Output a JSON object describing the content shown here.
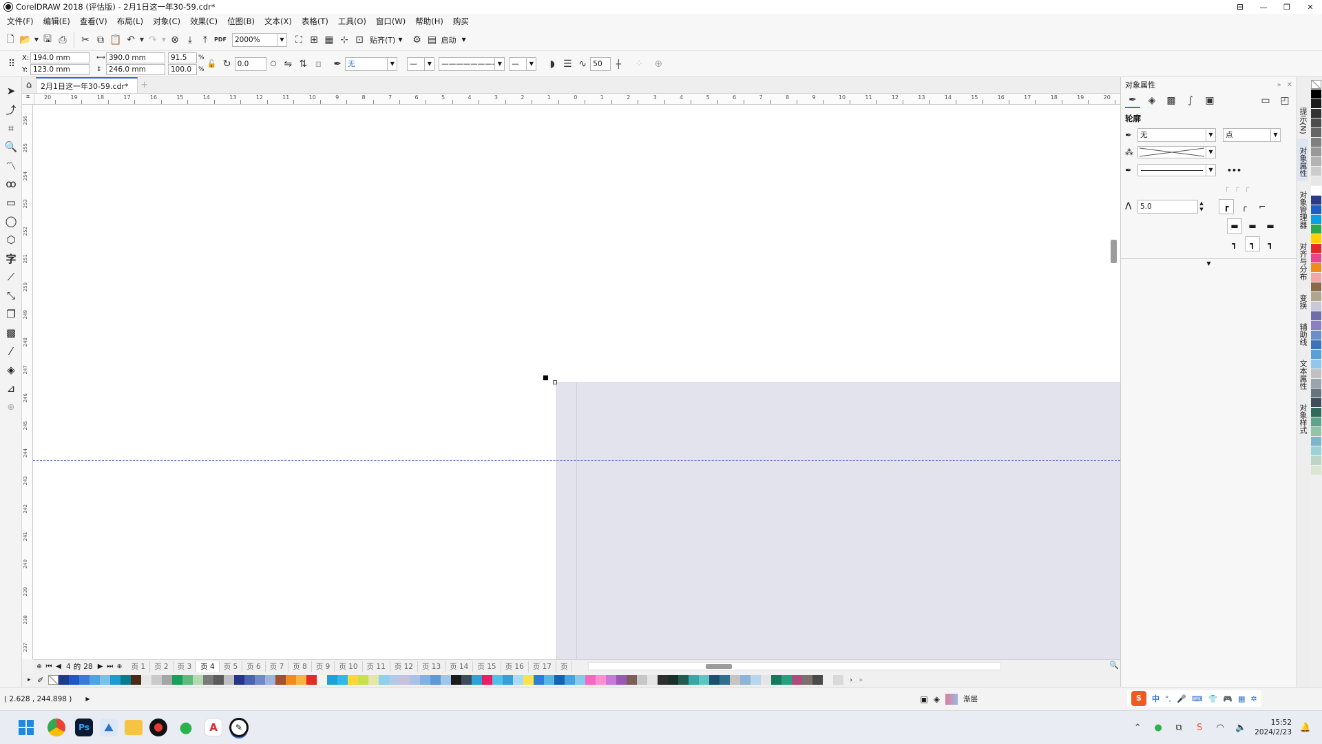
{
  "window": {
    "title": "CorelDRAW 2018 (评估版) - 2月1日这一年30-59.cdr*",
    "controls": [
      "⊟",
      "—",
      "❐",
      "✕"
    ]
  },
  "menu": [
    "文件(F)",
    "编辑(E)",
    "查看(V)",
    "布局(L)",
    "对象(C)",
    "效果(C)",
    "位图(B)",
    "文本(X)",
    "表格(T)",
    "工具(O)",
    "窗口(W)",
    "帮助(H)",
    "购买"
  ],
  "toolbar": {
    "zoom_value": "2000%",
    "snap_label": "贴齐(T)",
    "launch_label": "启动",
    "pdf_label": "PDF"
  },
  "props": {
    "x": "194.0 mm",
    "y": "123.0 mm",
    "w": "390.0 mm",
    "h": "246.0 mm",
    "scale_w": "91.5",
    "scale_h": "100.0",
    "pct": "%",
    "x_label": "X:",
    "y_label": "Y:",
    "rotation": "0.0",
    "fill_none": "无",
    "curve_value": "50"
  },
  "document": {
    "tab_title": "2月1日这一年30-59.cdr*"
  },
  "ruler": {
    "h_ticks": [
      "20",
      "19",
      "18",
      "17",
      "16",
      "15",
      "14",
      "13",
      "12",
      "11",
      "10",
      "9",
      "8",
      "7",
      "6",
      "5",
      "4",
      "3",
      "2",
      "1",
      "0",
      "1",
      "2",
      "3",
      "4",
      "5",
      "6",
      "7",
      "8",
      "9",
      "10",
      "11",
      "12",
      "13",
      "14",
      "15",
      "16",
      "17",
      "18",
      "19",
      "20"
    ],
    "v_ticks": [
      "256",
      "255",
      "254",
      "253",
      "252",
      "251",
      "250",
      "249",
      "248",
      "247",
      "246",
      "245",
      "244",
      "243",
      "242",
      "241",
      "240",
      "239",
      "238",
      "237"
    ]
  },
  "pages": {
    "current": "4",
    "of_label": "的",
    "total": "28",
    "tabs": [
      "页 1",
      "页 2",
      "页 3",
      "页 4",
      "页 5",
      "页 6",
      "页 7",
      "页 8",
      "页 9",
      "页 10",
      "页 11",
      "页 12",
      "页 13",
      "页 14",
      "页 15",
      "页 16",
      "页 17",
      "页"
    ],
    "active_index": 3
  },
  "palette": [
    "#1e3b8a",
    "#2156c4",
    "#3a7bd5",
    "#4fa3e0",
    "#79c1ea",
    "#1d9bd0",
    "#0a7a8f",
    "#4b2b18",
    "#e7e7e7",
    "#c9c9c9",
    "#a5a5a5",
    "#17a05a",
    "#5fba7d",
    "#b3d9b0",
    "#7a7a7a",
    "#5b5b5b",
    "#c0c0c0",
    "#27348b",
    "#4a62b0",
    "#6f89c9",
    "#9cb3de",
    "#a0522d",
    "#f08c1a",
    "#f6b441",
    "#e22b2b",
    "#f3f3f3",
    "#1ea0d8",
    "#2fb8e8",
    "#fdd835",
    "#c8e04a",
    "#e6e6a8",
    "#8fd0f0",
    "#b3c9e8",
    "#c7c1dd",
    "#a9c3e6",
    "#7fb2e5",
    "#5d9ad6",
    "#9ec7e8",
    "#1b1b1b",
    "#3f4a5c",
    "#2aa3d6",
    "#e91e63",
    "#53c0e8",
    "#3a9fd6",
    "#a6dcf5",
    "#ffe14d",
    "#2b7fd4",
    "#59b4e6",
    "#1463b5",
    "#47a3df",
    "#85c9ee",
    "#f468c2",
    "#ff8fd1",
    "#c77ad9",
    "#9b59b6",
    "#7b5e57",
    "#c7c7c7",
    "#e5e5e5",
    "#2e2e2e",
    "#1a2f2a",
    "#225b4f",
    "#3aa6a6",
    "#5ec3c3",
    "#1a4f6e",
    "#2f6f8f",
    "#c4c4c4",
    "#8db4d8",
    "#b8d6ee",
    "#e5e5e5",
    "#157a5b",
    "#28a07f",
    "#b04a7a",
    "#7a6e6e",
    "#4a4a4a",
    "#f0f0f0",
    "#d9d9d9"
  ],
  "vpalette": [
    "#000000",
    "#1a1a1a",
    "#333333",
    "#4d4d4d",
    "#666666",
    "#808080",
    "#999999",
    "#b3b3b3",
    "#cccccc",
    "#e6e6e6",
    "#ffffff",
    "#2b3a8c",
    "#1e5fc6",
    "#0aa0e8",
    "#2aa84a",
    "#fcd200",
    "#e6262d",
    "#ea4589",
    "#f08c1a",
    "#f2a6a6",
    "#8a6a4a",
    "#b0a68e",
    "#c8c8d8",
    "#6e6ea8",
    "#8b7fbf",
    "#6a8ec9",
    "#3a73b8",
    "#5aa0d8",
    "#91c7ea",
    "#c1c1c1",
    "#9aa4ae",
    "#67747f",
    "#3f4e5a",
    "#2e6b5a",
    "#5ea38d",
    "#93c4a8",
    "#7fb5c9",
    "#9bd3d8",
    "#bcd6c4",
    "#d8e6d2"
  ],
  "panel": {
    "title": "对象属性",
    "section": "轮廓",
    "outline_width": "无",
    "outline_unit": "点",
    "miter": "5.0",
    "tabs": [
      "提示(N)",
      "对象属性",
      "对象管理器",
      "对齐与分布",
      "变换",
      "辅助线",
      "文本属性",
      "对象样式"
    ]
  },
  "status": {
    "coords": "( 2.628 , 244.898 )",
    "fill_label": "渐层"
  },
  "taskbar": {
    "apps": [
      "windows-start",
      "chrome",
      "photoshop",
      "image-viewer",
      "file-explorer",
      "recorder",
      "wechat",
      "acrobat",
      "coreldraw"
    ],
    "ime": [
      "中",
      "°,"
    ],
    "time": "15:52",
    "date": "2024/2/23"
  },
  "colors": {
    "page_fill": "#e3e3ee",
    "guide": "#6a7ad8",
    "accent": "#2f6fd0"
  }
}
